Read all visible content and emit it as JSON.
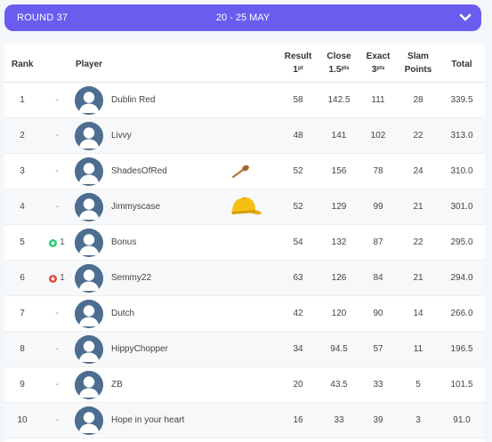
{
  "round": {
    "label": "ROUND 37",
    "dates": "20 - 25 MAY"
  },
  "columns": {
    "rank": "Rank",
    "player": "Player",
    "result": "Result",
    "result_pts": "1",
    "result_sup": "pt",
    "close": "Close",
    "close_pts": "1.5",
    "close_sup": "pts",
    "exact": "Exact",
    "exact_pts": "3",
    "exact_sup": "pts",
    "slam_line1": "Slam",
    "slam_line2": "Points",
    "total": "Total"
  },
  "colors": {
    "accent": "#6b5cf0",
    "up": "#2ecc71",
    "down": "#e74c3c"
  },
  "rows": [
    {
      "rank": "1",
      "movement": "-",
      "movement_dir": "none",
      "player": "Dublin Red",
      "result": "58",
      "close": "142.5",
      "exact": "111",
      "slam": "28",
      "total": "339.5",
      "badge": ""
    },
    {
      "rank": "2",
      "movement": "-",
      "movement_dir": "none",
      "player": "Livvy",
      "result": "48",
      "close": "141",
      "exact": "102",
      "slam": "22",
      "total": "313.0",
      "badge": ""
    },
    {
      "rank": "3",
      "movement": "-",
      "movement_dir": "none",
      "player": "ShadesOfRed",
      "result": "52",
      "close": "156",
      "exact": "78",
      "slam": "24",
      "total": "310.0",
      "badge": "wooden-spoon-icon"
    },
    {
      "rank": "4",
      "movement": "-",
      "movement_dir": "none",
      "player": "Jimmyscase",
      "result": "52",
      "close": "129",
      "exact": "99",
      "slam": "21",
      "total": "301.0",
      "badge": "yellow-cap-icon"
    },
    {
      "rank": "5",
      "movement": "1",
      "movement_dir": "up",
      "player": "Bonus",
      "result": "54",
      "close": "132",
      "exact": "87",
      "slam": "22",
      "total": "295.0",
      "badge": ""
    },
    {
      "rank": "6",
      "movement": "1",
      "movement_dir": "down",
      "player": "Semmy22",
      "result": "63",
      "close": "126",
      "exact": "84",
      "slam": "21",
      "total": "294.0",
      "badge": ""
    },
    {
      "rank": "7",
      "movement": "-",
      "movement_dir": "none",
      "player": "Dutch",
      "result": "42",
      "close": "120",
      "exact": "90",
      "slam": "14",
      "total": "266.0",
      "badge": ""
    },
    {
      "rank": "8",
      "movement": "-",
      "movement_dir": "none",
      "player": "HippyChopper",
      "result": "34",
      "close": "94.5",
      "exact": "57",
      "slam": "11",
      "total": "196.5",
      "badge": ""
    },
    {
      "rank": "9",
      "movement": "-",
      "movement_dir": "none",
      "player": "ZB",
      "result": "20",
      "close": "43.5",
      "exact": "33",
      "slam": "5",
      "total": "101.5",
      "badge": ""
    },
    {
      "rank": "10",
      "movement": "-",
      "movement_dir": "none",
      "player": "Hope in your heart",
      "result": "16",
      "close": "33",
      "exact": "39",
      "slam": "3",
      "total": "91.0",
      "badge": ""
    }
  ]
}
